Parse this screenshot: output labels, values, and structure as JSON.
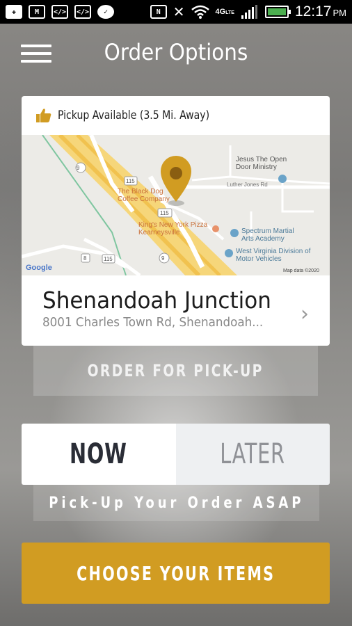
{
  "status_bar": {
    "time": "12:17",
    "ampm": "PM",
    "network": "4G",
    "network_sub": "LTE",
    "icons": [
      "plus-icon",
      "gmail-icon",
      "code-icon",
      "code-icon",
      "messenger-icon",
      "nfc-icon",
      "mute-icon",
      "wifi-icon",
      "signal-icon",
      "battery-icon"
    ],
    "battery_level": 1.0
  },
  "header": {
    "title": "Order Options"
  },
  "location_card": {
    "availability": "Pickup Available (3.5 Mi. Away)",
    "name": "Shenandoah Junction",
    "address": "8001 Charles Town Rd, Shenandoah...",
    "map": {
      "labels": {
        "church": "Jesus The Open Door Ministry",
        "road": "Luther Jones Rd",
        "coffee": "The Black Dog Coffee Company",
        "pizza": "King's New York Pizza Kearneysville",
        "martial": "Spectrum Martial Arts Academy",
        "dmv": "West Virginia Division of Motor Vehicles",
        "route9a": "9",
        "route9b": "9",
        "route115a": "115",
        "route115b": "115",
        "route115c": "115",
        "route8": "8",
        "google": "Google",
        "attribution": "Map data ©2020"
      }
    }
  },
  "order_type": "ORDER FOR PICK-UP",
  "timing": {
    "now": "NOW",
    "later": "LATER",
    "selected": "now",
    "description": "Pick-Up Your Order ASAP"
  },
  "cta": "CHOOSE YOUR ITEMS",
  "colors": {
    "accent": "#d19c22",
    "status_bar": "#000000",
    "battery": "#4caf50"
  }
}
